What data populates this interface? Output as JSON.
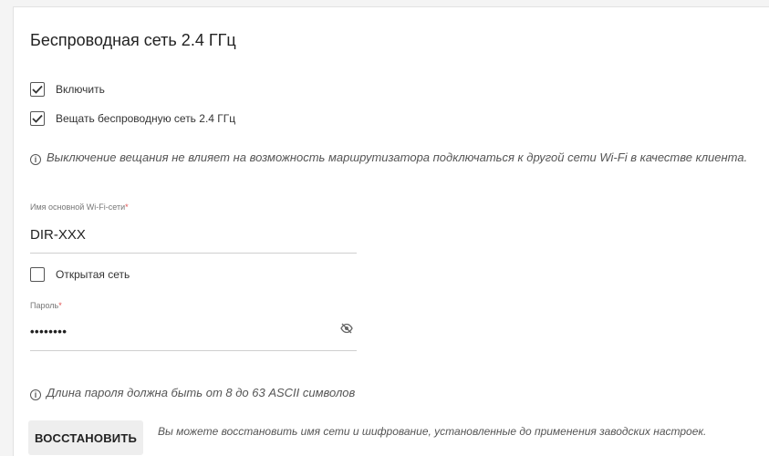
{
  "section": {
    "title": "Беспроводная сеть 2.4 ГГц"
  },
  "checkboxes": {
    "enable": {
      "label": "Включить",
      "checked": true
    },
    "broadcast": {
      "label": "Вещать беспроводную сеть 2.4 ГГц",
      "checked": true
    },
    "open_network": {
      "label": "Открытая сеть",
      "checked": false
    }
  },
  "notes": {
    "broadcast_info": "Выключение вещания не влияет на возможность маршрутизатора подключаться к другой сети Wi-Fi в качестве клиента.",
    "password_info": "Длина пароля должна быть от 8 до 63 ASCII символов",
    "restore_info": "Вы можете восстановить имя сети и шифрование, установленные до применения заводских настроек."
  },
  "fields": {
    "ssid": {
      "label": "Имя основной Wi-Fi-сети",
      "required_mark": "*",
      "value": "DIR-XXX"
    },
    "password": {
      "label": "Пароль",
      "required_mark": "*",
      "value": "••••••••"
    }
  },
  "buttons": {
    "restore": "ВОССТАНОВИТЬ"
  },
  "icons": {
    "info": "info-icon",
    "eye": "eye-off-icon",
    "check": "check-icon"
  }
}
